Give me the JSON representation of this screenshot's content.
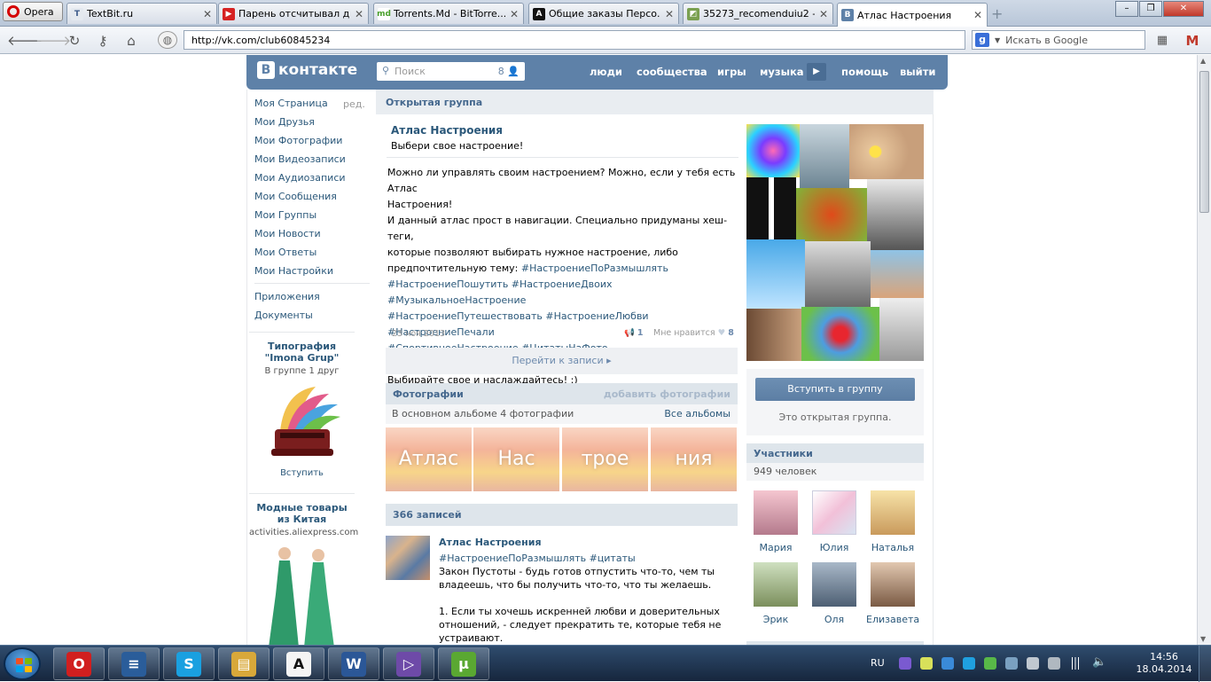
{
  "browser": {
    "menu_label": "Opera",
    "tabs": [
      {
        "title": "TextBit.ru",
        "favicon": "textbit-icon",
        "color": "#e4e9ef",
        "fg": "#3c5a8a",
        "glyph": "T"
      },
      {
        "title": "Парень отсчитывал д...",
        "favicon": "youtube-icon",
        "color": "#d62222",
        "fg": "#ffffff",
        "glyph": "▶"
      },
      {
        "title": "Torrents.Md - BitTorre...",
        "favicon": "torrents-md-icon",
        "color": "#ffffff",
        "fg": "#4aa02c",
        "glyph": "md"
      },
      {
        "title": "Общие заказы Персо...",
        "favicon": "advego-icon",
        "color": "#111111",
        "fg": "#ffffff",
        "glyph": "A"
      },
      {
        "title": "35273_recomenduiu2 - ...",
        "favicon": "image-icon",
        "color": "#7aa050",
        "fg": "#ffffff",
        "glyph": "◩"
      },
      {
        "title": "Атлас Настроения",
        "favicon": "vk-icon",
        "color": "#5e81a8",
        "fg": "#ffffff",
        "glyph": "В"
      }
    ],
    "url": "http://vk.com/club60845234",
    "search_placeholder": "Искать в Google"
  },
  "vk": {
    "logo_letter": "В",
    "logo_text": "контакте",
    "search_placeholder": "Поиск",
    "search_count": "8",
    "nav": [
      "люди",
      "сообщества",
      "игры",
      "музыка",
      "помощь",
      "выйти"
    ],
    "left_menu": [
      "Моя Страница",
      "Мои Друзья",
      "Мои Фотографии",
      "Мои Видеозаписи",
      "Мои Аудиозаписи",
      "Мои Сообщения",
      "Мои Группы",
      "Мои Новости",
      "Мои Ответы",
      "Мои Настройки"
    ],
    "left_edit": "ред.",
    "left_menu2": [
      "Приложения",
      "Документы"
    ],
    "ads": [
      {
        "title": "Типография \"Imona Grup\"",
        "subtitle": "В группе 1 друг",
        "action": "Вступить"
      },
      {
        "title": "Модные товары из Китая",
        "subtitle": "activities.aliexpress.com"
      }
    ]
  },
  "group": {
    "type_label": "Открытая группа",
    "name": "Атлас Настроения",
    "status": "Выбери свое настроение!",
    "desc_lines": [
      "Можно ли управлять своим настроением? Можно, если у тебя есть Атлас",
      "Настроения!",
      "И данный атлас прост в навигации. Специально придуманы хеш-теги,",
      "которые позволяют выбирать нужное настроение, либо"
    ],
    "desc_prefix": "предпочтительную тему: ",
    "tags": [
      "#НастроениеПоРазмышлять",
      "#НастроениеПошутить",
      "#НастроениеДвоих",
      "#МузыкальноеНастроение",
      "#НастроениеПутешествовать",
      "#НастроениеЛюбви",
      "#НастроениеПечали",
      "#СпортивноеНастроение",
      "#ЦитатыНаФото"
    ],
    "desc_footer": "Выбирайте свое и наслаждайтесь! :)",
    "date": "23 ноя 2013",
    "reposts": "1",
    "like_label": "Мне нравится",
    "likes": "8",
    "goto_posts": "Перейти к записи",
    "photos_label": "Фотографии",
    "add_photos": "добавить фотографии",
    "album_note": "В основном альбоме 4 фотографии",
    "all_albums": "Все альбомы",
    "photo_words": [
      "Атлас",
      "Нас",
      "трое",
      "ния"
    ],
    "posts_count": "366 записей",
    "wall_author": "Атлас Настроения",
    "wall_tags": "#НастроениеПоРазмышлять #цитаты",
    "wall_lines": [
      "Закон Пустоты - будь готов отпустить что-то, чем ты",
      "владеешь, что бы получить что-то, что ты желаешь.",
      "",
      "1. Если ты хочешь искренней любви и доверительных",
      "отношений, - следует прекратить те, которые тебя не",
      "устраивают."
    ],
    "join_button": "Вступить в группу",
    "join_note": "Это открытая группа.",
    "members_label": "Участники",
    "members_count": "949 человек",
    "members": [
      "Мария",
      "Юлия",
      "Наталья",
      "Эрик",
      "Оля",
      "Елизавета"
    ]
  },
  "taskbar": {
    "language": "RU",
    "time": "14:56",
    "date": "18.04.2014",
    "apps": [
      "opera-app-icon",
      "textru-app-icon",
      "skype-app-icon",
      "explorer-app-icon",
      "advego-app-icon",
      "word-app-icon",
      "visual-studio-app-icon",
      "utorrent-app-icon"
    ]
  }
}
